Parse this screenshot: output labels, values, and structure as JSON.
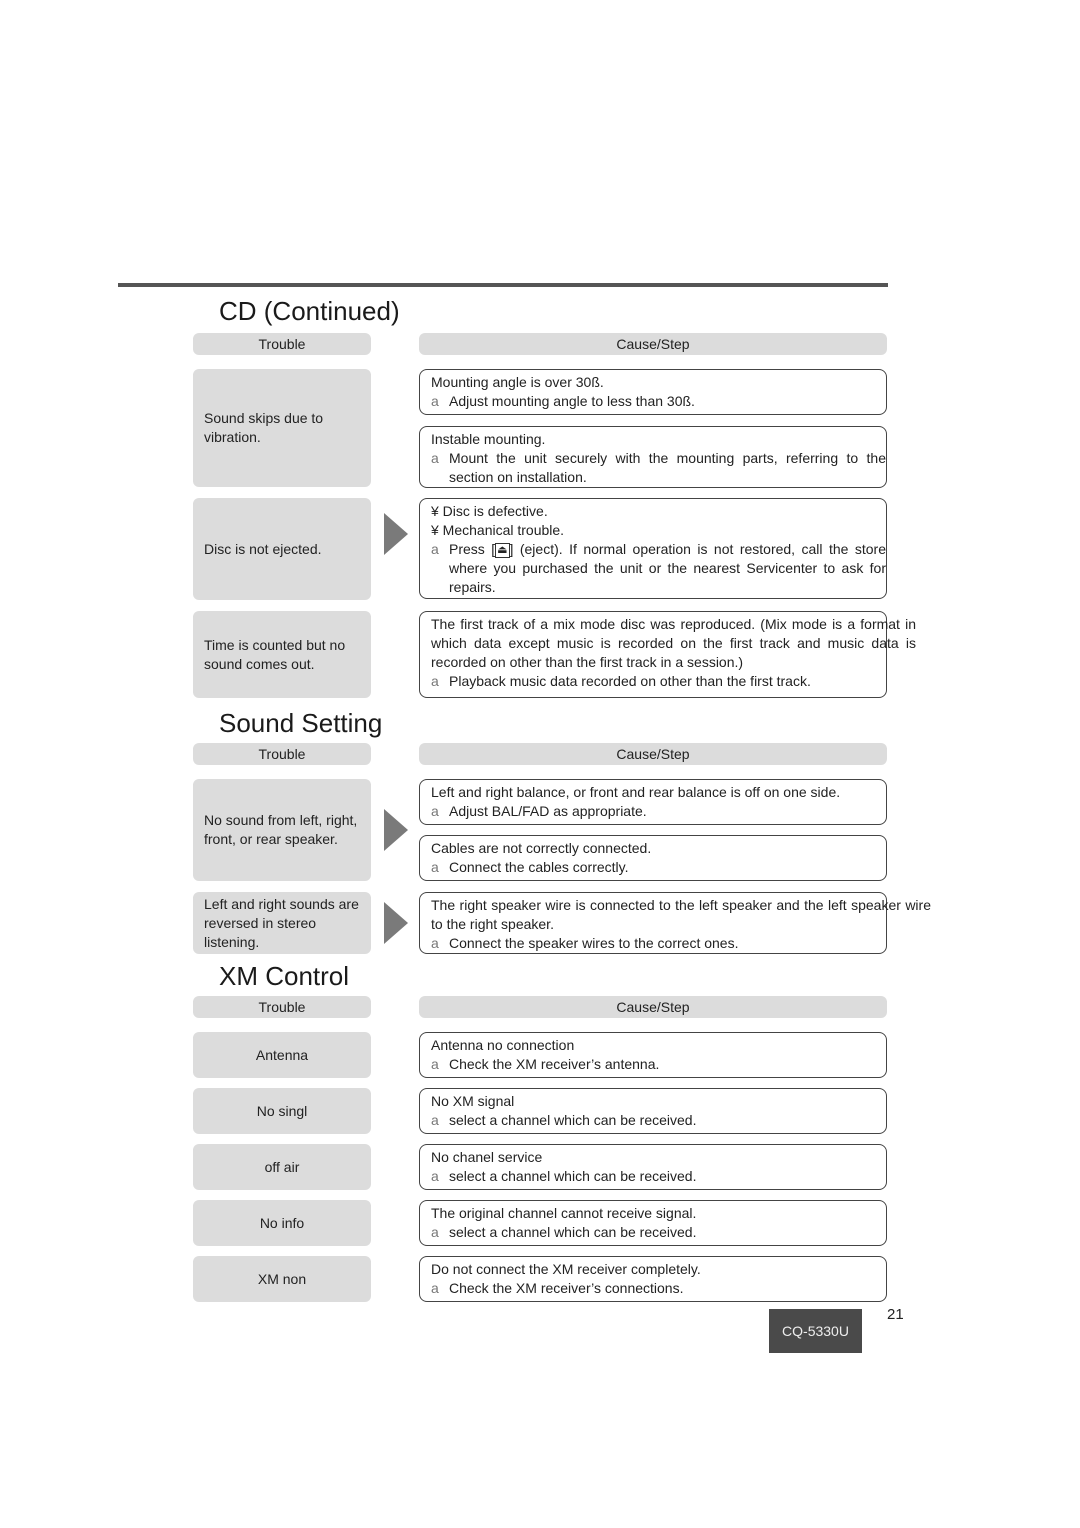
{
  "sections": {
    "cd": {
      "title": "CD (Continued)",
      "header_trouble": "Trouble",
      "header_cause": "Cause/Step",
      "rows": [
        {
          "trouble": "Sound skips due to vibration.",
          "causes": [
            {
              "lines": [
                "Mounting angle is over 30ß."
              ],
              "step": "Adjust mounting angle to less than 30ß."
            },
            {
              "lines": [
                "Instable mounting."
              ],
              "step": "Mount the unit securely with the mounting parts, referring to the section on installation."
            }
          ]
        },
        {
          "trouble": "Disc is not ejected.",
          "causes": [
            {
              "lines": [
                "¥ Disc is defective.",
                "¥ Mechanical trouble."
              ],
              "step_pre": "Press [",
              "step_icon": "eject-icon",
              "step_post": "] (eject). If normal operation is not restored, call the store where you purchased the unit or the nearest Servicenter to ask for repairs."
            }
          ]
        },
        {
          "trouble": "Time is counted but no sound comes out.",
          "causes": [
            {
              "lines": [
                "The first track of a mix mode disc was reproduced. (Mix mode is a format in which data except music is recorded on the first track and music data is recorded on other than the first track in a session.)"
              ],
              "step": "Playback music data recorded on other than the first track."
            }
          ]
        }
      ]
    },
    "sound": {
      "title": "Sound Setting",
      "header_trouble": "Trouble",
      "header_cause": "Cause/Step",
      "rows": [
        {
          "trouble": "No sound from left, right, front, or rear speaker.",
          "causes": [
            {
              "lines": [
                "Left and right balance, or front and rear balance is off on one side."
              ],
              "step": "Adjust BAL/FAD as appropriate."
            },
            {
              "lines": [
                "Cables are not correctly connected."
              ],
              "step": "Connect the cables correctly."
            }
          ]
        },
        {
          "trouble": "Left and right sounds are reversed in stereo listening.",
          "causes": [
            {
              "lines": [
                "The right speaker wire is connected to the left speaker and the left speaker wire to the right speaker."
              ],
              "step": "Connect the speaker wires to the correct ones."
            }
          ]
        }
      ]
    },
    "xm": {
      "title": "XM Control",
      "header_trouble": "Trouble",
      "header_cause": "Cause/Step",
      "rows": [
        {
          "trouble": "Antenna",
          "cause": "Antenna no connection",
          "step": "Check the XM receiver’s antenna."
        },
        {
          "trouble": "No singl",
          "cause": "No XM signal",
          "step": "select a channel which can be received."
        },
        {
          "trouble": "off air",
          "cause": "No chanel service",
          "step": "select a channel which can be received."
        },
        {
          "trouble": "No info",
          "cause": "The original channel cannot receive signal.",
          "step": "select a channel which can be received."
        },
        {
          "trouble": "XM non",
          "cause": "Do not connect the XM receiver completely.",
          "step": "Check the XM receiver’s connections."
        }
      ]
    }
  },
  "step_marker": "a",
  "footer": {
    "model": "CQ-5330U",
    "page_number": "21"
  }
}
